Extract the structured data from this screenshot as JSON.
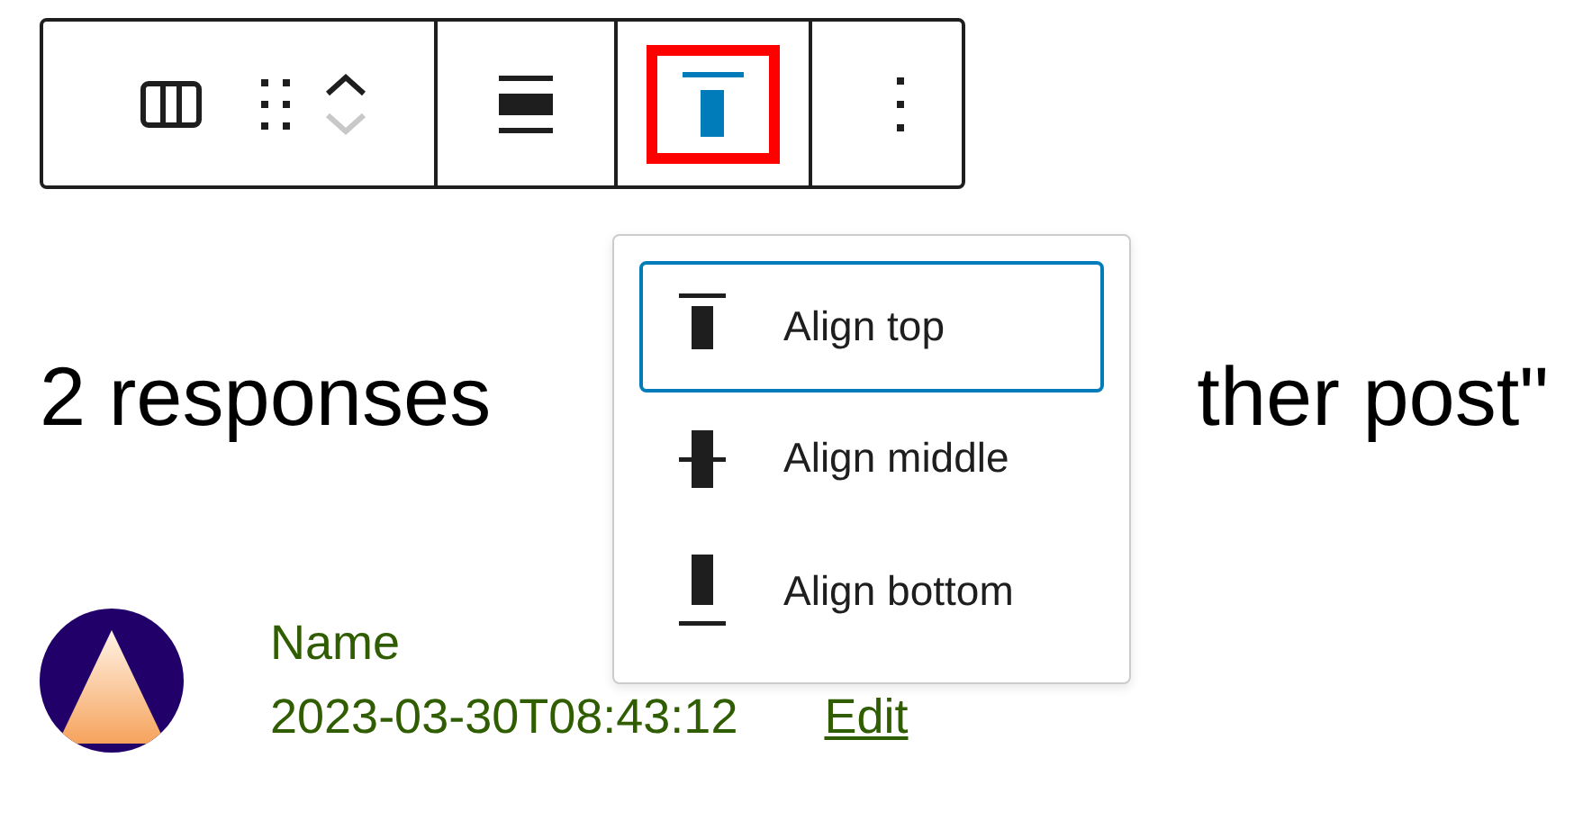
{
  "toolbar": {
    "groups": [
      {
        "buttons": [
          {
            "kind": "block"
          },
          {
            "kind": "drag"
          },
          {
            "kind": "movers"
          }
        ]
      },
      {
        "buttons": [
          {
            "kind": "justify"
          }
        ]
      },
      {
        "buttons": [
          {
            "kind": "valign",
            "active": true,
            "highlighted": true
          }
        ]
      },
      {
        "buttons": [
          {
            "kind": "more"
          }
        ]
      }
    ]
  },
  "heading": {
    "visible_start": "2 responses",
    "visible_end": "ther post\""
  },
  "menu": {
    "items": [
      {
        "kind": "top",
        "label": "Align top",
        "selected": true
      },
      {
        "kind": "middle",
        "label": "Align middle",
        "selected": false
      },
      {
        "kind": "bottom",
        "label": "Align bottom",
        "selected": false
      }
    ]
  },
  "comment": {
    "author": "Name",
    "date": "2023-03-30T08:43:12",
    "edit_link": "Edit"
  }
}
